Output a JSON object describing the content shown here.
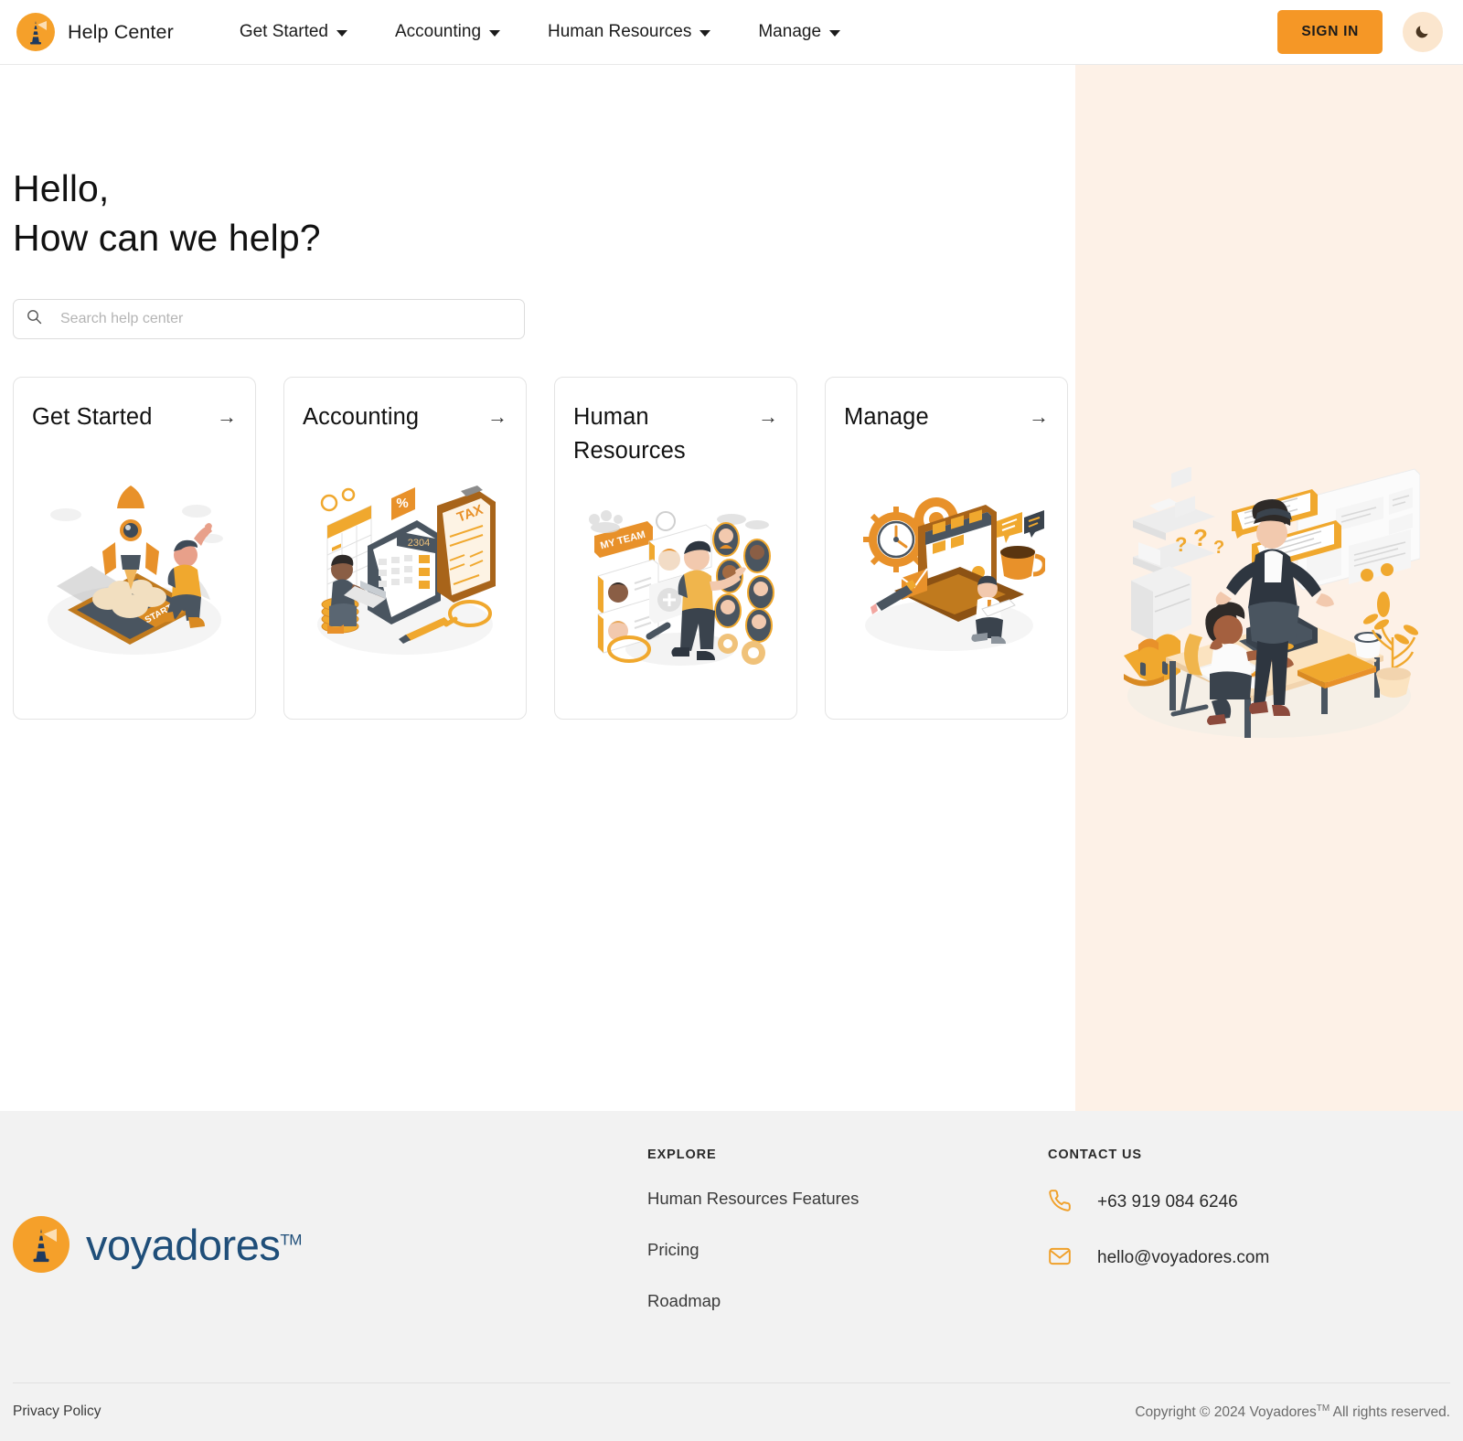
{
  "colors": {
    "accent": "#F59726",
    "logo_orange": "#F5A02A",
    "brand_navy": "#1F4E79",
    "right_panel_bg": "#FDF1E7",
    "footer_bg": "#F2F2F2",
    "toggle_bg": "#FBE6CE"
  },
  "navbar": {
    "logo_icon": "lighthouse-icon",
    "brand_title": "Help Center",
    "links": [
      {
        "label": "Get Started",
        "caret": "chevron-down-icon"
      },
      {
        "label": "Accounting",
        "caret": "chevron-down-icon"
      },
      {
        "label": "Human Resources",
        "caret": "chevron-down-icon"
      },
      {
        "label": "Manage",
        "caret": "chevron-down-icon"
      }
    ],
    "sign_in_label": "SIGN IN",
    "theme_toggle_icon": "moon-icon"
  },
  "hero": {
    "greeting": "Hello,",
    "question": "How can we help?",
    "search": {
      "icon": "search-icon",
      "placeholder": "Search help center",
      "value": ""
    },
    "illustration": "office-help-illustration"
  },
  "cards": [
    {
      "title": "Get Started",
      "arrow": "arrow-right-icon",
      "illustration": "rocket-launch-illustration"
    },
    {
      "title": "Accounting",
      "arrow": "arrow-right-icon",
      "illustration": "tax-calculator-illustration"
    },
    {
      "title": "Human Resources",
      "arrow": "arrow-right-icon",
      "illustration": "my-team-illustration"
    },
    {
      "title": "Manage",
      "arrow": "arrow-right-icon",
      "illustration": "dashboard-gears-illustration"
    }
  ],
  "footer": {
    "logo_icon": "lighthouse-icon",
    "wordmark": "voyadores",
    "wordmark_tm": "TM",
    "explore": {
      "title": "EXPLORE",
      "links": [
        "Human Resources Features",
        "Pricing",
        "Roadmap"
      ]
    },
    "contact": {
      "title": "CONTACT US",
      "phone_icon": "phone-icon",
      "phone": "+63 919 084 6246",
      "email_icon": "mail-icon",
      "email": "hello@voyadores.com"
    },
    "privacy_label": "Privacy Policy",
    "copyright_prefix": "Copyright © 2024 Voyadores",
    "copyright_tm": "TM",
    "copyright_suffix": " All rights reserved."
  }
}
